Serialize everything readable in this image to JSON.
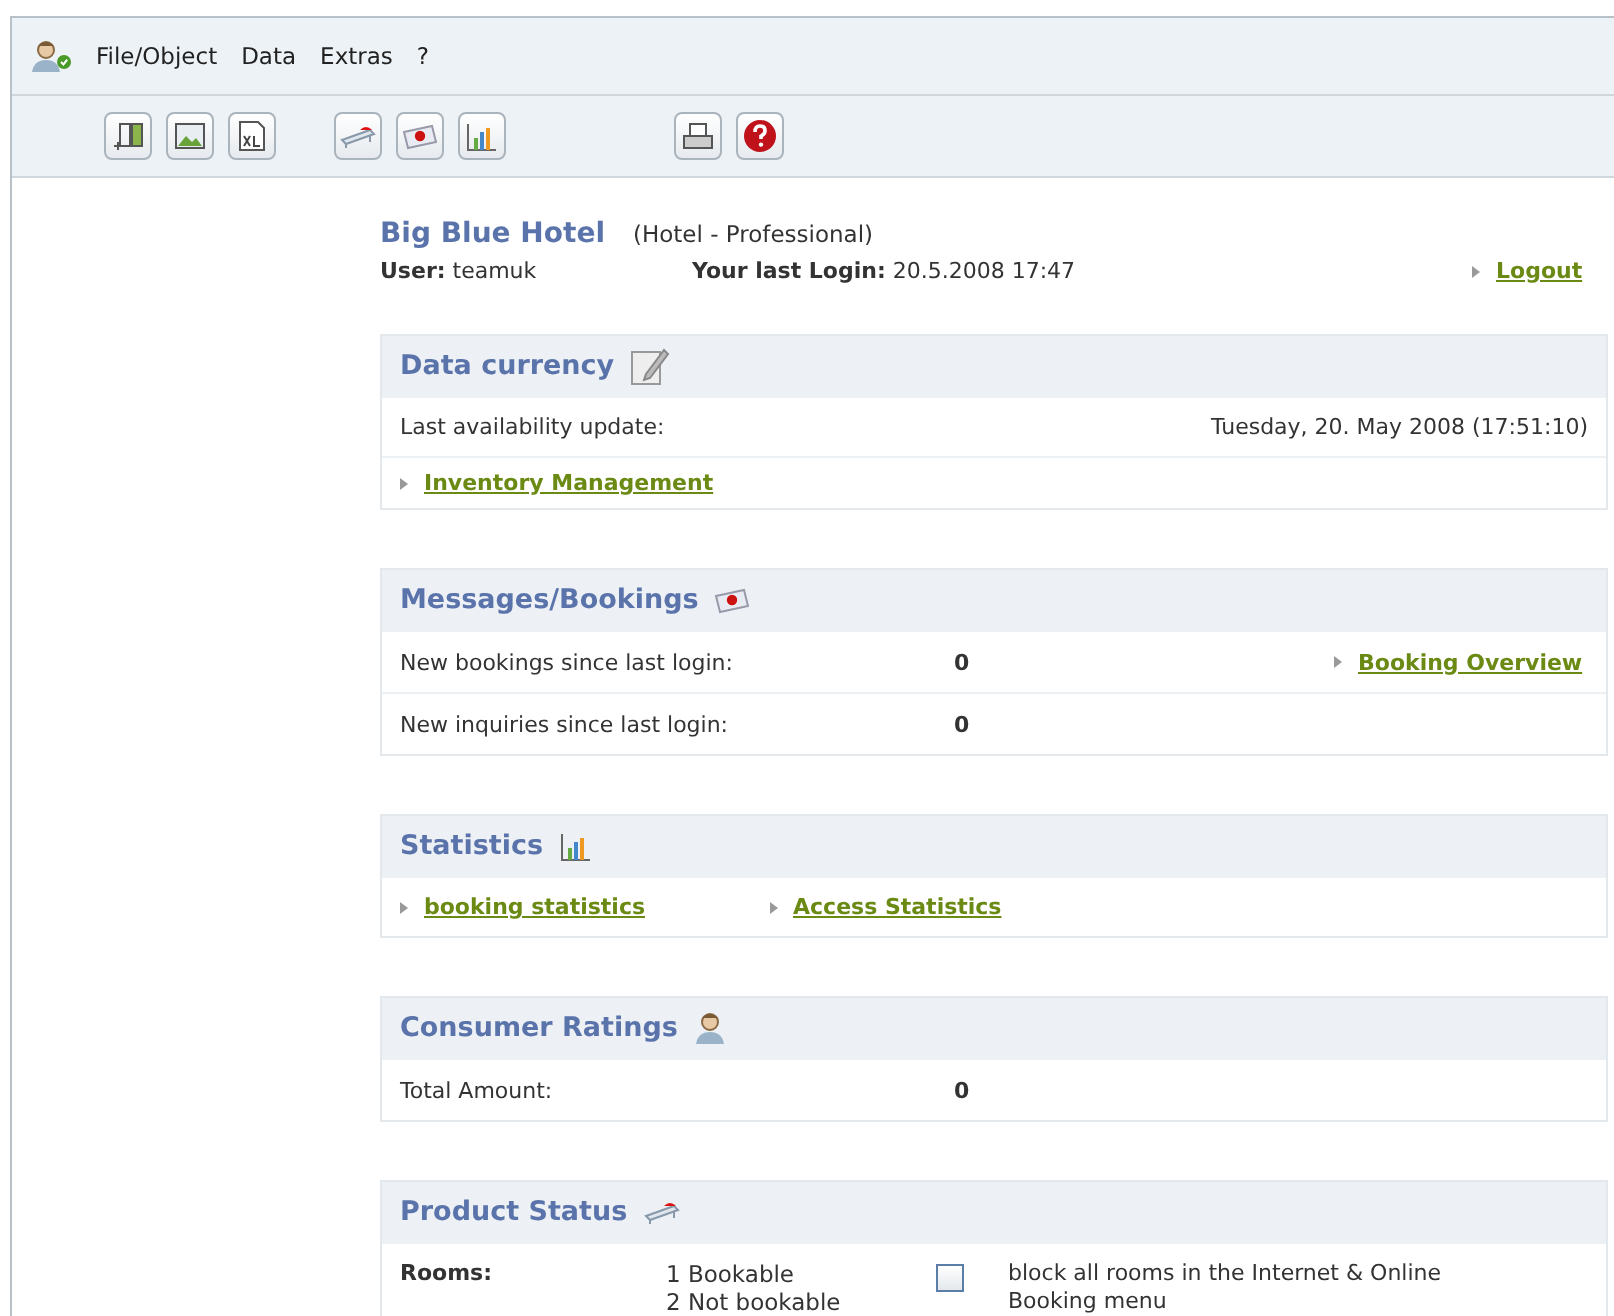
{
  "menu": [
    "File/Object",
    "Data",
    "Extras",
    "?"
  ],
  "header": {
    "hotel": "Big Blue Hotel",
    "category": "(Hotel - Professional)",
    "user_label": "User:",
    "user": "teamuk",
    "login_label": "Your last Login:",
    "login": "20.5.2008  17:47",
    "logout": "Logout"
  },
  "sections": [
    {
      "title": "Data currency",
      "rows": [
        {
          "kind": "split",
          "label": "Last availability update:",
          "value": "Tuesday, 20. May 2008 (17:51:10)"
        },
        {
          "kind": "links",
          "links": [
            "Inventory Management"
          ]
        }
      ]
    },
    {
      "title": "Messages/Bookings",
      "rows": [
        {
          "kind": "count",
          "label": "New bookings since last login:",
          "value": "0",
          "link": "Booking Overview"
        },
        {
          "kind": "count",
          "label": "New inquiries since last login:",
          "value": "0"
        }
      ]
    },
    {
      "title": "Statistics",
      "rows": [
        {
          "kind": "links",
          "links": [
            "booking statistics",
            "Access Statistics"
          ]
        }
      ]
    },
    {
      "title": "Consumer Ratings",
      "rows": [
        {
          "kind": "count",
          "label": "Total Amount:",
          "value": "0"
        }
      ]
    },
    {
      "title": "Product Status",
      "rows": [
        {
          "kind": "status",
          "label": "Rooms:",
          "lines": [
            "1 Bookable",
            "2 Not bookable"
          ],
          "checked": false,
          "note": "block all rooms in the Internet & Online Booking menu"
        }
      ]
    }
  ]
}
